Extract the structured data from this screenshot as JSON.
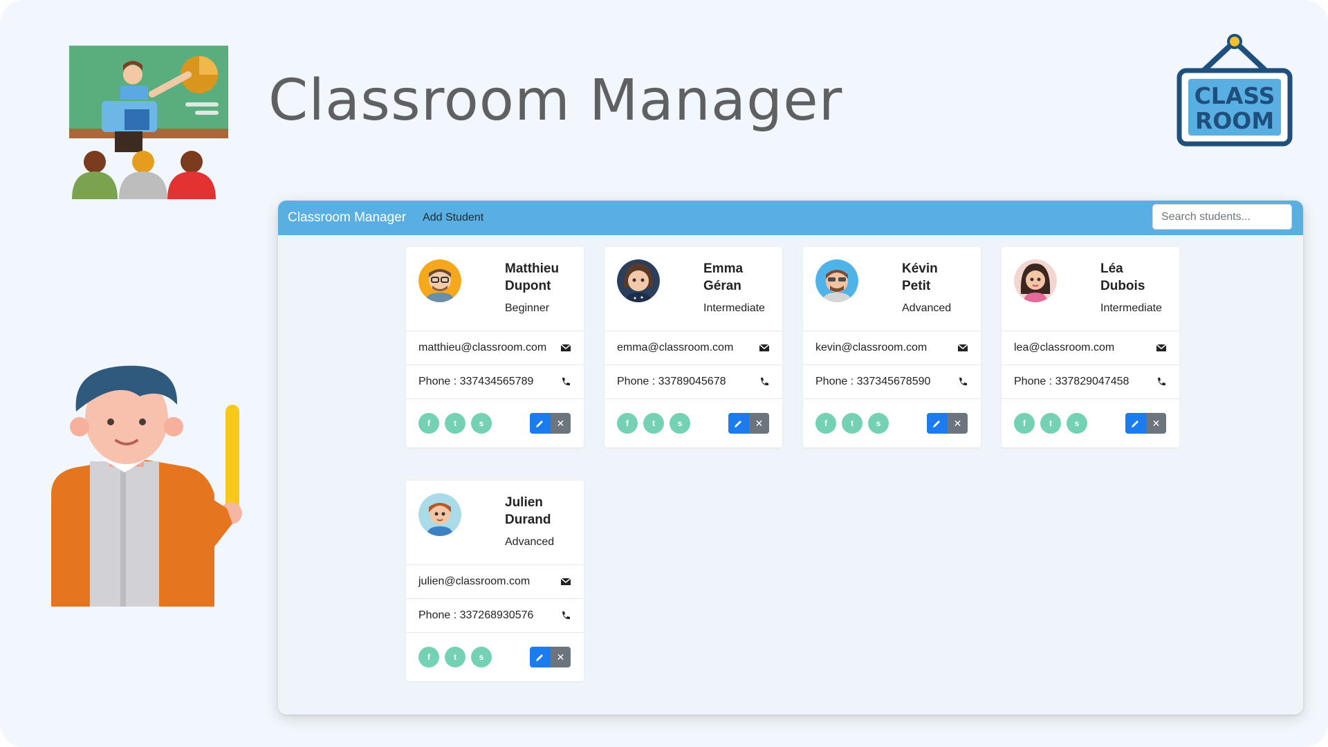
{
  "hero": {
    "title": "Classroom Manager"
  },
  "sign": {
    "line1": "CLASS",
    "line2": "ROOM"
  },
  "navbar": {
    "brand": "Classroom Manager",
    "add_student": "Add Student",
    "search_placeholder": "Search students..."
  },
  "students": [
    {
      "first": "Matthieu",
      "last": "Dupont",
      "level": "Beginner",
      "email": "matthieu@classroom.com",
      "phone": "Phone : 337434565789"
    },
    {
      "first": "Emma",
      "last": "Géran",
      "level": "Intermediate",
      "email": "emma@classroom.com",
      "phone": "Phone : 33789045678"
    },
    {
      "first": "Kévin",
      "last": "Petit",
      "level": "Advanced",
      "email": "kevin@classroom.com",
      "phone": "Phone : 337345678590"
    },
    {
      "first": "Léa",
      "last": "Dubois",
      "level": "Intermediate",
      "email": "lea@classroom.com",
      "phone": "Phone : 337829047458"
    },
    {
      "first": "Julien",
      "last": "Durand",
      "level": "Advanced",
      "email": "julien@classroom.com",
      "phone": "Phone : 337268930576"
    }
  ],
  "social_icons": [
    "facebook-icon",
    "twitter-icon",
    "skype-icon"
  ],
  "colors": {
    "navbar": "#5aafe2",
    "social": "#74d1b4",
    "edit": "#1b7cf2",
    "delete": "#6c757d"
  }
}
